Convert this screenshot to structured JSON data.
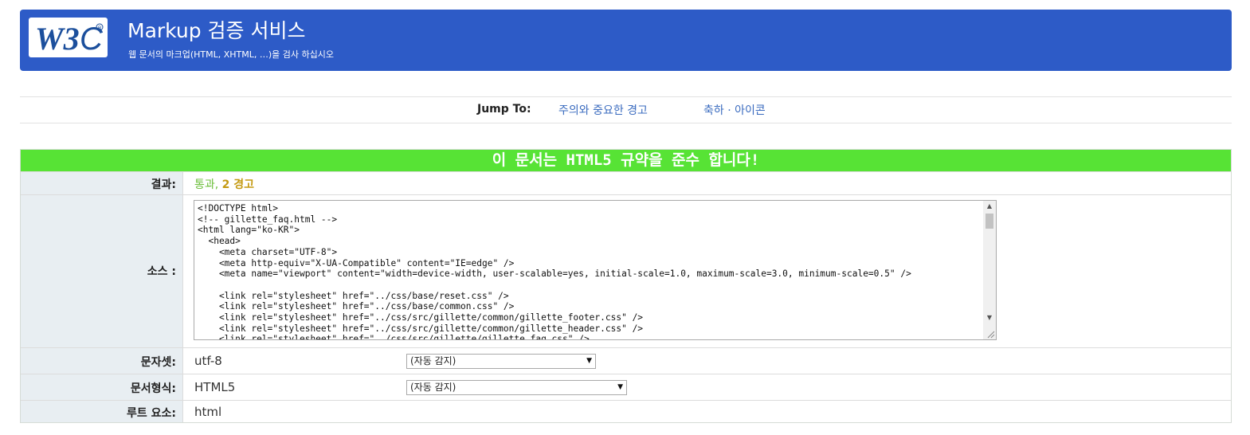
{
  "header": {
    "logo_text": "W3C",
    "title": "Markup 검증 서비스",
    "subtitle": "웹 문서의 마크업(HTML, XHTML, …)을 검사 하십시오",
    "brand_color": "#2d5bc7"
  },
  "jump": {
    "label": "Jump To:",
    "links": [
      "주의와 중요한 경고",
      "축하 · 아이콘"
    ]
  },
  "result": {
    "banner": "이 문서는 HTML5 규약을 준수 합니다!",
    "banner_color": "#57e335",
    "rows": {
      "result": {
        "label": "결과:",
        "pass": "통과,",
        "warning": "2 경고"
      },
      "source": {
        "label": "소스 :",
        "code": "<!DOCTYPE html>\n<!-- gillette_faq.html -->\n<html lang=\"ko-KR\">\n  <head>\n    <meta charset=\"UTF-8\">\n    <meta http-equiv=\"X-UA-Compatible\" content=\"IE=edge\" />\n    <meta name=\"viewport\" content=\"width=device-width, user-scalable=yes, initial-scale=1.0, maximum-scale=3.0, minimum-scale=0.5\" />\n\n    <link rel=\"stylesheet\" href=\"../css/base/reset.css\" />\n    <link rel=\"stylesheet\" href=\"../css/base/common.css\" />\n    <link rel=\"stylesheet\" href=\"../css/src/gillette/common/gillette_footer.css\" />\n    <link rel=\"stylesheet\" href=\"../css/src/gillette/common/gillette_header.css\" />\n    <link rel=\"stylesheet\" href=\"../css/src/gillette/gillette_faq.css\" />"
      },
      "charset": {
        "label": "문자셋:",
        "value": "utf-8",
        "select": "(자동 감지)"
      },
      "doctype": {
        "label": "문서형식:",
        "value": "HTML5",
        "select": "(자동 감지)"
      },
      "root": {
        "label": "루트 요소:",
        "value": "html"
      }
    }
  },
  "colors": {
    "pass": "#6dbf3c",
    "warning": "#c49a12",
    "link": "#3a6bbf"
  }
}
